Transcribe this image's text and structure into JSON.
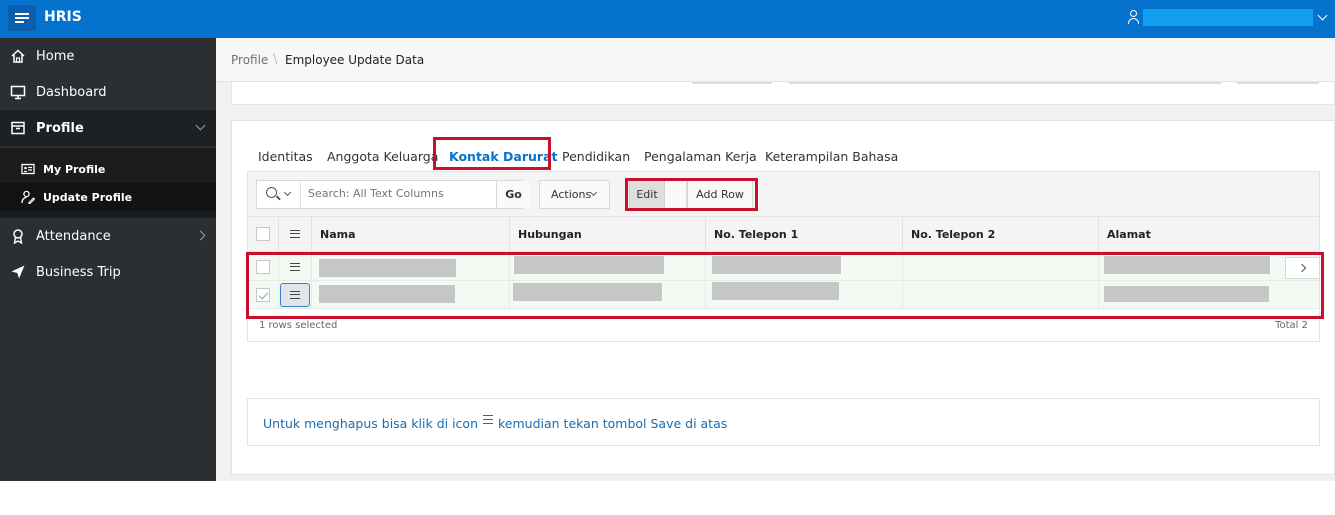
{
  "header": {
    "app_title": "HRIS"
  },
  "sidebar": {
    "items": [
      {
        "label": "Home",
        "icon": "home-icon"
      },
      {
        "label": "Dashboard",
        "icon": "monitor-icon"
      },
      {
        "label": "Profile",
        "icon": "profile-box-icon"
      },
      {
        "label": "Attendance",
        "icon": "award-icon"
      },
      {
        "label": "Business Trip",
        "icon": "send-icon"
      }
    ],
    "subitems": [
      {
        "label": "My Profile",
        "icon": "id-card-icon"
      },
      {
        "label": "Update Profile",
        "icon": "user-edit-icon"
      }
    ]
  },
  "breadcrumb": {
    "parent": "Profile",
    "separator": "\\",
    "current": "Employee Update Data"
  },
  "tabs": [
    {
      "label": "Identitas"
    },
    {
      "label": "Anggota Keluarga"
    },
    {
      "label": "Kontak Darurat"
    },
    {
      "label": "Pendidikan"
    },
    {
      "label": "Pengalaman Kerja"
    },
    {
      "label": "Keterampilan Bahasa"
    }
  ],
  "toolbar": {
    "search_placeholder": "Search: All Text Columns",
    "go_label": "Go",
    "actions_label": "Actions",
    "edit_label": "Edit",
    "add_row_label": "Add Row"
  },
  "grid": {
    "columns": [
      "Nama",
      "Hubungan",
      "No. Telepon 1",
      "No. Telepon 2",
      "Alamat"
    ],
    "selected_text": "1 rows selected",
    "total_text": "Total 2"
  },
  "note": {
    "text_before": "Untuk menghapus bisa klik di icon",
    "text_after": "kemudian tekan tombol Save di atas"
  },
  "colors": {
    "header_blue": "#0572ce",
    "sidebar_dark": "#2c2f32",
    "highlight_red": "#c8102e",
    "link_blue": "#1a6cb0"
  }
}
